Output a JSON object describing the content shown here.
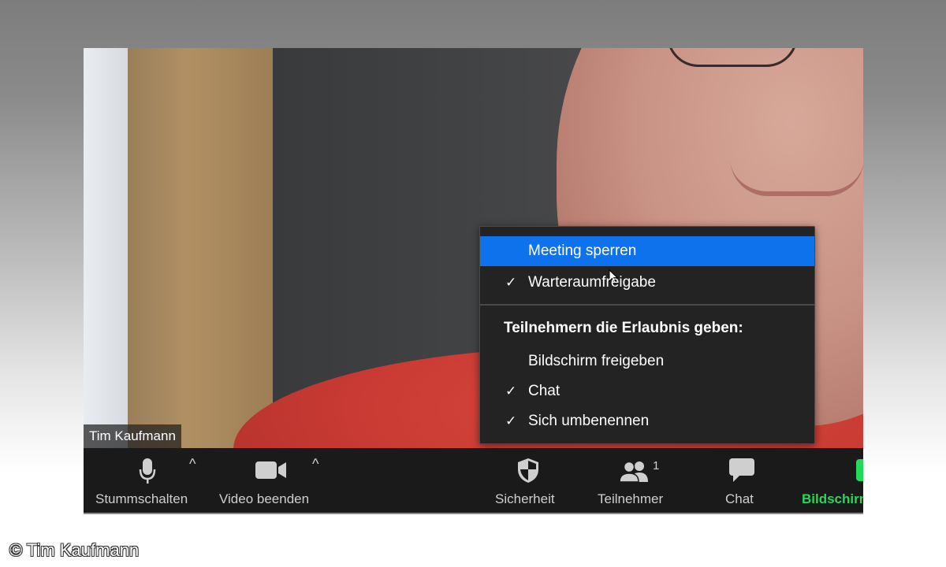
{
  "participant": {
    "name": "Tim Kaufmann"
  },
  "security_menu": {
    "items": [
      {
        "label": "Meeting sperren",
        "checked": false,
        "highlighted": true
      },
      {
        "label": "Warteraumfreigabe",
        "checked": true,
        "highlighted": false
      }
    ],
    "section_header": "Teilnehmern die Erlaubnis geben:",
    "permissions": [
      {
        "label": "Bildschirm freigeben",
        "checked": false
      },
      {
        "label": "Chat",
        "checked": true
      },
      {
        "label": "Sich umbenennen",
        "checked": true
      }
    ],
    "check_glyph": "✓",
    "highlight_color": "#0e72ed"
  },
  "toolbar": {
    "mute_label": "Stummschalten",
    "video_label": "Video beenden",
    "security_label": "Sicherheit",
    "participants_label": "Teilnehmer",
    "participants_count": "1",
    "chat_label": "Chat",
    "share_label": "Bildschirm",
    "caret_glyph": "^",
    "share_color": "#23d959"
  },
  "copyright": "© Tim Kaufmann"
}
